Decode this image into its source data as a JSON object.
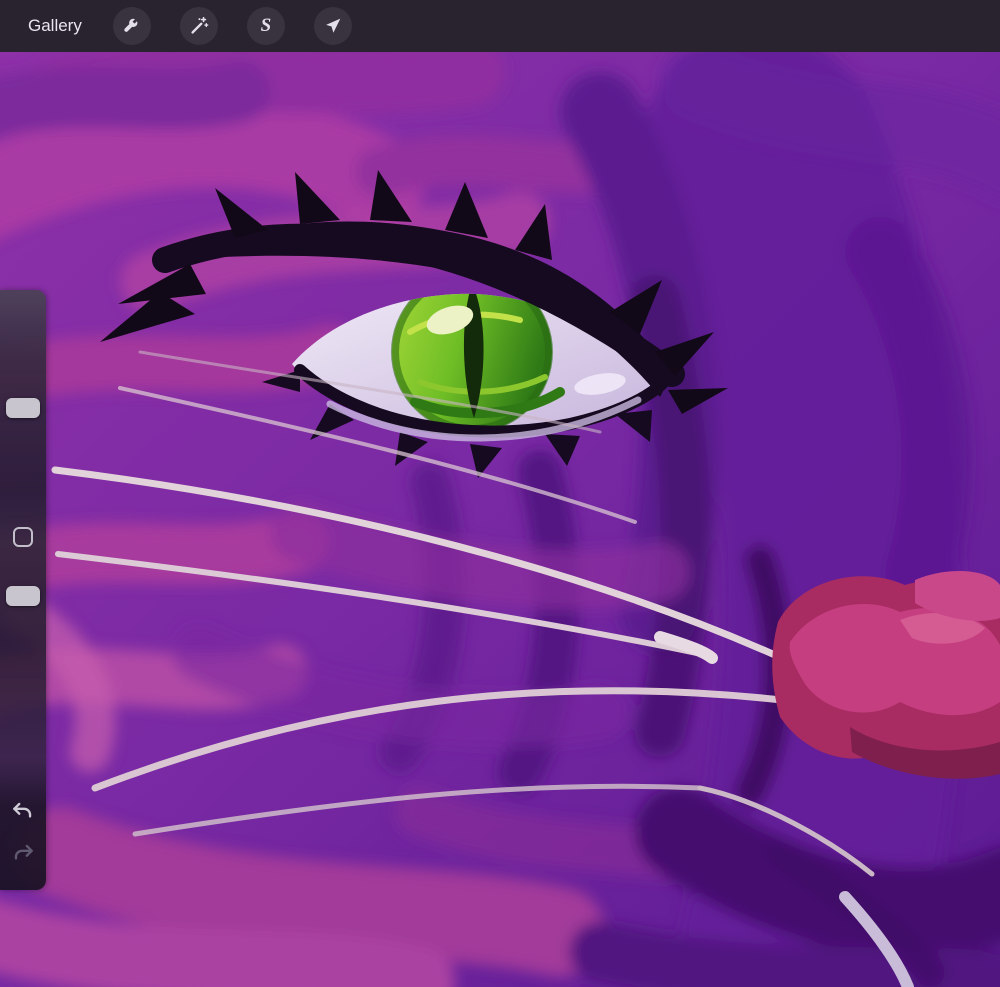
{
  "topbar": {
    "gallery_label": "Gallery",
    "selection_glyph": "S",
    "bg_color": "#29222f",
    "button_bg_color": "#39323f",
    "icon_color": "#e3e0e9",
    "buttons": [
      {
        "name": "actions-button",
        "icon": "wrench-icon"
      },
      {
        "name": "adjustments-button",
        "icon": "magic-wand-icon"
      },
      {
        "name": "selection-button",
        "icon": "selection-s-icon"
      },
      {
        "name": "transform-button",
        "icon": "transform-arrow-icon"
      }
    ]
  },
  "sidebar": {
    "thumb_color": "#c9c5cf",
    "controls": [
      {
        "name": "brush-size-slider"
      },
      {
        "name": "modify-button"
      },
      {
        "name": "opacity-slider"
      },
      {
        "name": "undo-button"
      },
      {
        "name": "redo-button"
      }
    ]
  },
  "canvas": {
    "subject": "close-up painting of a purple cat face with green eye, whiskers and pink nose",
    "palette": {
      "base_purple": "#7a2aa4",
      "magenta": "#aa39a2",
      "deep_purple": "#47106e",
      "eye_green_light": "#a6d838",
      "eye_green_dark": "#2f7a16",
      "pupil_green_black": "#132a0b",
      "eye_highlight": "#edf2c6",
      "sclera": "#ddd2ea",
      "lash_black": "#150a20",
      "whisker": "#d9c6d2",
      "nose_pink": "#c53e80",
      "nose_dark": "#7e1f4e"
    }
  }
}
